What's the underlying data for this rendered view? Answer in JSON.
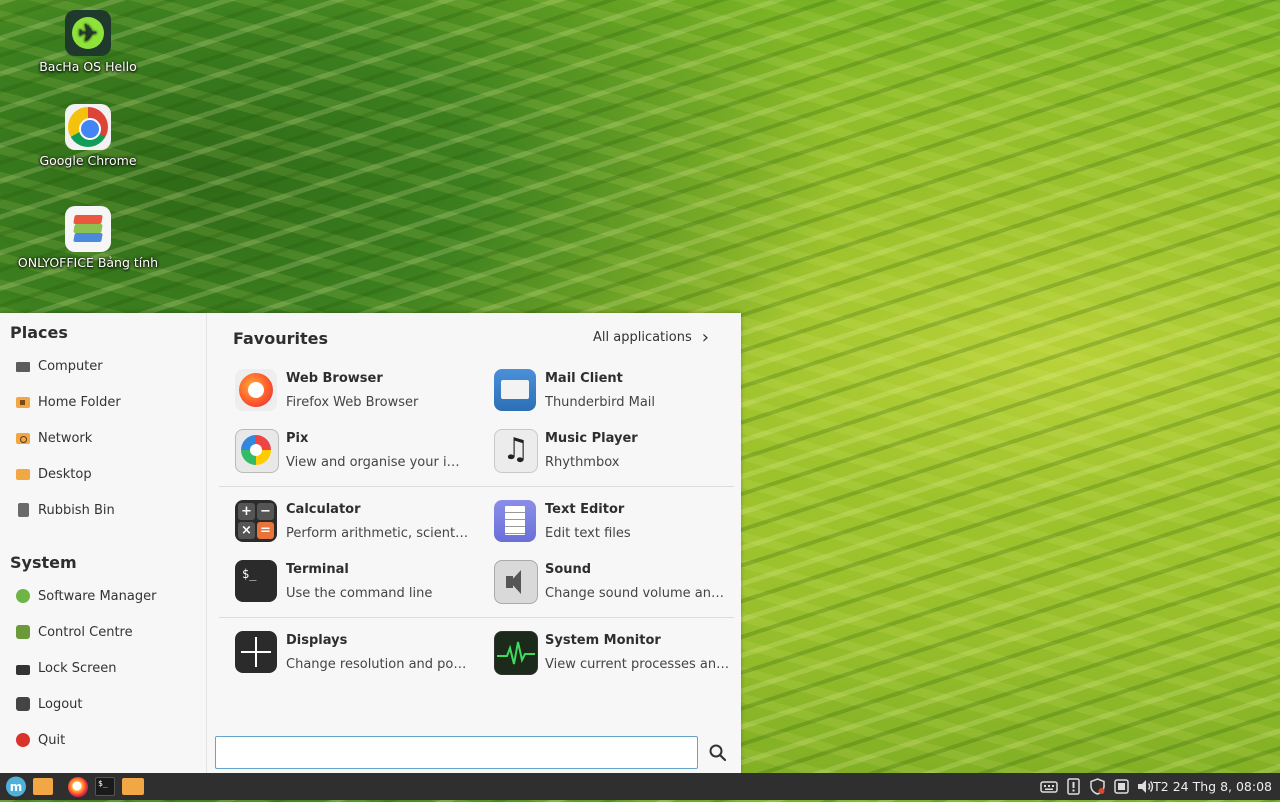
{
  "desktop": {
    "icons": [
      {
        "label": "BacHa OS Hello",
        "icon": "bacha-hello-icon"
      },
      {
        "label": "Google Chrome",
        "icon": "chrome-icon"
      },
      {
        "label": "ONLYOFFICE Bảng tính",
        "icon": "onlyoffice-icon"
      }
    ]
  },
  "menu": {
    "places": {
      "title": "Places",
      "items": [
        "Computer",
        "Home Folder",
        "Network",
        "Desktop",
        "Rubbish Bin"
      ]
    },
    "system": {
      "title": "System",
      "items": [
        "Software Manager",
        "Control Centre",
        "Lock Screen",
        "Logout",
        "Quit"
      ]
    },
    "favourites": {
      "title": "Favourites",
      "all_apps_label": "All applications",
      "apps": [
        {
          "name": "Web Browser",
          "desc": "Firefox Web Browser",
          "icon": "firefox-icon"
        },
        {
          "name": "Mail Client",
          "desc": "Thunderbird Mail",
          "icon": "mail-icon"
        },
        {
          "name": "Pix",
          "desc": "View and organise your images",
          "icon": "pix-icon"
        },
        {
          "name": "Music Player",
          "desc": "Rhythmbox",
          "icon": "music-icon"
        },
        {
          "name": "Calculator",
          "desc": "Perform arithmetic, scientific or financial calculations",
          "icon": "calculator-icon"
        },
        {
          "name": "Text Editor",
          "desc": "Edit text files",
          "icon": "text-editor-icon"
        },
        {
          "name": "Terminal",
          "desc": "Use the command line",
          "icon": "terminal-icon"
        },
        {
          "name": "Sound",
          "desc": "Change sound volume and sound events",
          "icon": "sound-icon"
        },
        {
          "name": "Displays",
          "desc": "Change resolution and position of monitors",
          "icon": "displays-icon"
        },
        {
          "name": "System Monitor",
          "desc": "View current processes and monitor system state",
          "icon": "system-monitor-icon"
        }
      ]
    },
    "search": {
      "value": "",
      "placeholder": ""
    }
  },
  "taskbar": {
    "clock": "T2 24 Thg 8, 08:08",
    "launchers": [
      "menu-icon",
      "files-icon",
      "firefox-icon",
      "terminal-icon",
      "folder-icon"
    ],
    "tray": [
      "keyboard-icon",
      "update-icon",
      "shield-icon",
      "network-icon",
      "volume-icon"
    ],
    "terminal_glyph": "$_"
  },
  "colors": {
    "menu_bg": "#f7f7f7",
    "taskbar_bg": "#2f2f2f",
    "accent": "#6aa3c9",
    "folder": "#f0a744"
  }
}
